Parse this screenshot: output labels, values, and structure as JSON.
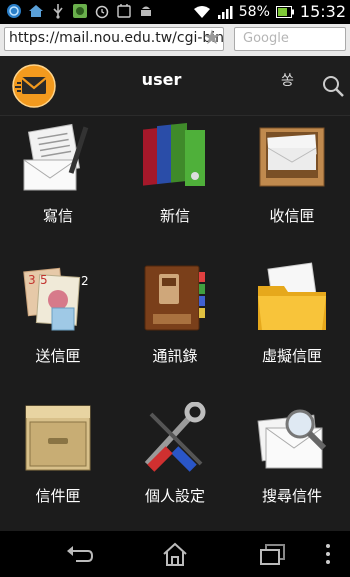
{
  "status_bar": {
    "battery": "58%",
    "time": "15:32",
    "icons": [
      "notification-globe-icon",
      "home-icon",
      "usb-icon",
      "android-robot-icon",
      "alarm-icon",
      "cart-icon",
      "android-icon",
      "wifi-icon",
      "signal-icon",
      "battery-icon"
    ]
  },
  "browser": {
    "url": "https://mail.nou.edu.tw/cgi-bin",
    "search_placeholder": "Google"
  },
  "header": {
    "title": "user",
    "sort_glyph": "쏭"
  },
  "tiles": [
    {
      "label": "寫信",
      "icon": "write-mail-icon"
    },
    {
      "label": "新信",
      "icon": "new-mail-folders-icon"
    },
    {
      "label": "收信匣",
      "icon": "inbox-tray-icon"
    },
    {
      "label": "送信匣",
      "icon": "sent-stamps-icon",
      "badge": "2"
    },
    {
      "label": "通訊錄",
      "icon": "address-book-icon"
    },
    {
      "label": "虛擬信匣",
      "icon": "virtual-folder-icon"
    },
    {
      "label": "信件匣",
      "icon": "mail-cabinet-icon"
    },
    {
      "label": "個人設定",
      "icon": "settings-tools-icon"
    },
    {
      "label": "搜尋信件",
      "icon": "search-mail-icon"
    }
  ],
  "nav": {
    "icons": [
      "back-icon",
      "home-nav-icon",
      "recent-apps-icon",
      "menu-icon"
    ]
  },
  "colors": {
    "background": "#1c1c1c",
    "status_bar": "#000000",
    "browser_bar": "#e9e9e9",
    "logo_orange": "#f39a1e"
  }
}
